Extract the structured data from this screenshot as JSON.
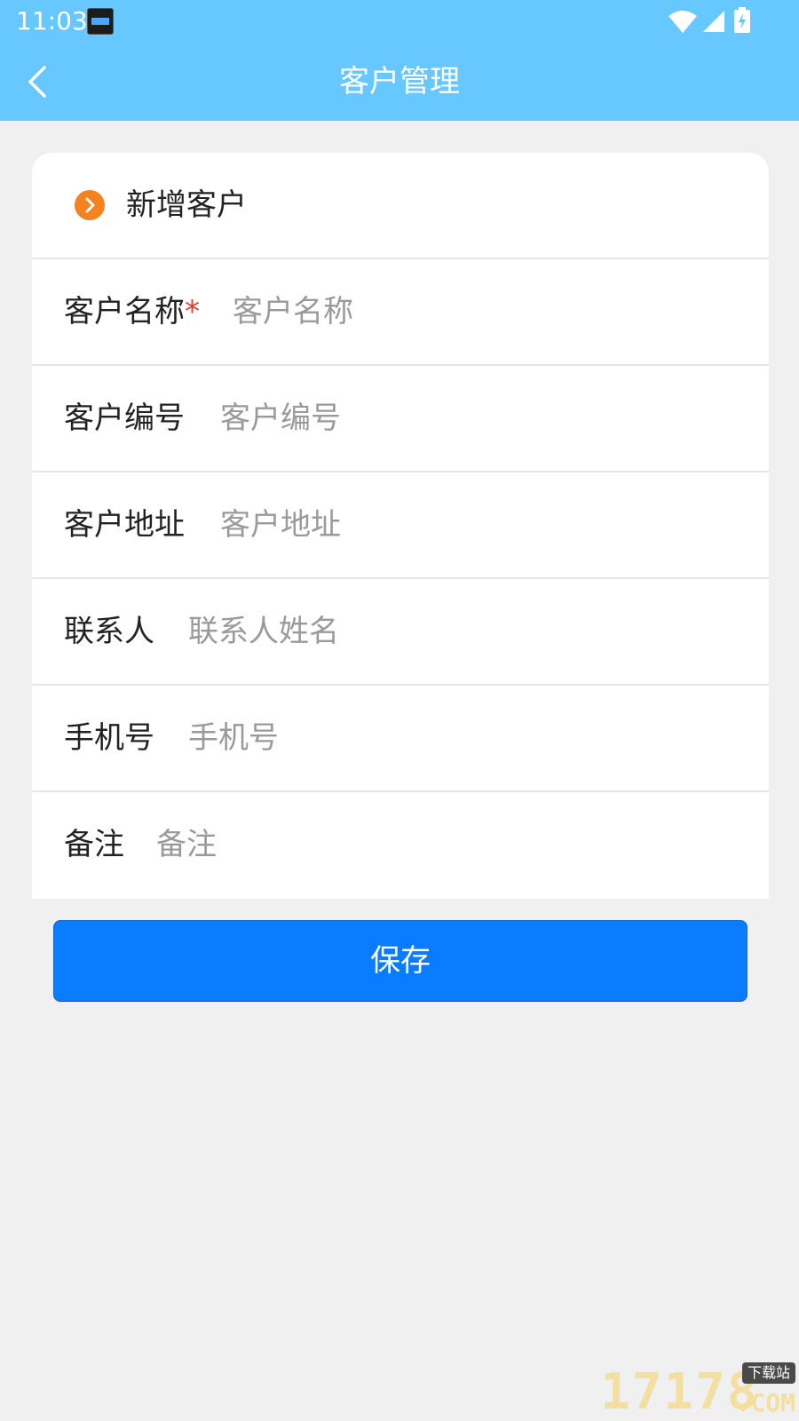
{
  "status_bar": {
    "time": "11:03",
    "notification_icon": "clock-widget-app-icon",
    "icons": [
      "wifi-icon",
      "signal-icon",
      "battery-charging-icon"
    ]
  },
  "app_bar": {
    "back_icon": "chevron-left-icon",
    "title": "客户管理",
    "background_color": "#66c8ff"
  },
  "section": {
    "icon": "chevron-circle-right-icon",
    "icon_color": "#f58220",
    "title": "新增客户"
  },
  "form": {
    "fields": [
      {
        "label": "客户名称",
        "required_mark": "*",
        "placeholder": "客户名称",
        "value": ""
      },
      {
        "label": "客户编号",
        "placeholder": "客户编号",
        "value": ""
      },
      {
        "label": "客户地址",
        "placeholder": "客户地址",
        "value": ""
      },
      {
        "label": "联系人",
        "placeholder": "联系人姓名",
        "value": ""
      },
      {
        "label": "手机号",
        "placeholder": "手机号",
        "value": ""
      },
      {
        "label": "备注",
        "placeholder": "备注",
        "value": ""
      }
    ]
  },
  "actions": {
    "save_label": "保存",
    "save_color": "#0a7cff"
  },
  "watermark": {
    "number": "17178",
    "tag": "下载站",
    "suffix": ".COM"
  }
}
